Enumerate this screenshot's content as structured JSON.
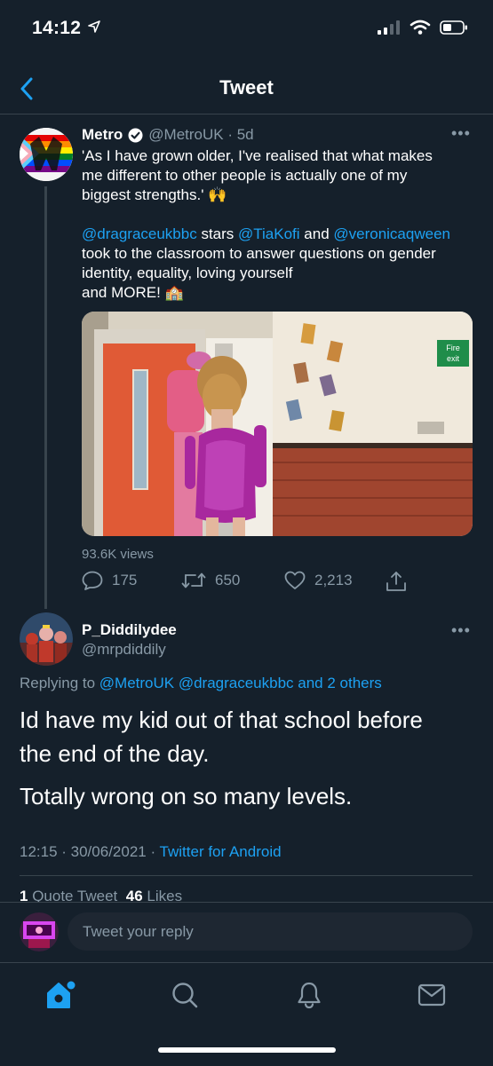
{
  "status_bar": {
    "time": "14:12"
  },
  "header": {
    "title": "Tweet"
  },
  "quoted_tweet": {
    "author_name": "Metro",
    "handle_and_time": "@MetroUK · 5d",
    "text_line1": "'As I have grown older, I've realised that what makes",
    "text_line2": "me different to other people is actually one of my",
    "text_line3": "biggest strengths.' 🙌",
    "mention1": "@dragraceukbbc",
    "mid_word": " stars ",
    "mention2": "@TiaKofi",
    "and_word": " and ",
    "mention3": "@veronicaqween",
    "text2_line2": "took to the classroom to answer questions on gender",
    "text2_line3": "identity, equality, loving yourself",
    "text2_line4": "and MORE! 🏫",
    "video_sign": "Fire exit",
    "views": "93.6K views",
    "reply_count": "175",
    "retweet_count": "650",
    "like_count": "2,213"
  },
  "main_tweet": {
    "author_name": "P_Diddilydee",
    "handle": "@mrpdiddily",
    "replying_prefix": "Replying to ",
    "replying_mentions": "@MetroUK @dragraceukbbc and 2 others",
    "text_line1": "Id have my kid out of that school before",
    "text_line2": "the end of the day.",
    "text_line3": "Totally wrong on so many levels.",
    "timestamp": "12:15 · 30/06/2021 · ",
    "client": "Twitter for Android",
    "quote_count": "1",
    "quote_label": " Quote Tweet",
    "likes_count": "46",
    "likes_label": " Likes"
  },
  "reply_box": {
    "placeholder": "Tweet your reply"
  },
  "tab_bar": {
    "items": [
      "home-icon",
      "search-icon",
      "notifications-icon",
      "messages-icon"
    ]
  },
  "colors": {
    "background": "#15202b",
    "accent": "#1da1f2",
    "muted": "#8899a6",
    "divider": "#38444d"
  }
}
